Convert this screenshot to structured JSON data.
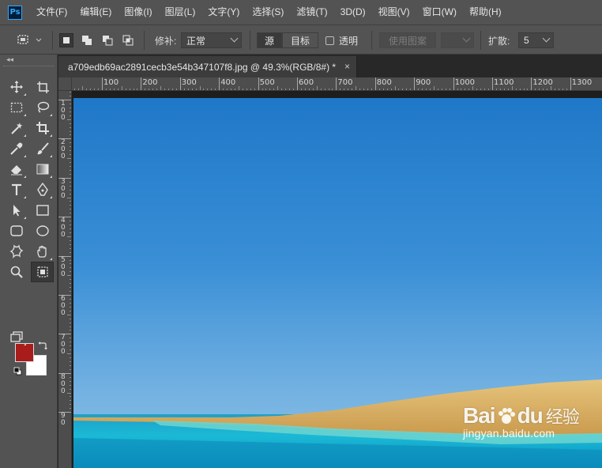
{
  "app": {
    "logo": "Ps",
    "icon": "photoshop-logo-icon"
  },
  "menu": [
    "文件(F)",
    "编辑(E)",
    "图像(I)",
    "图层(L)",
    "文字(Y)",
    "选择(S)",
    "滤镜(T)",
    "3D(D)",
    "视图(V)",
    "窗口(W)",
    "帮助(H)"
  ],
  "options": {
    "tool_preset_icon": "patch-tool-icon",
    "mode_icons": [
      "new-selection-icon",
      "add-to-selection-icon",
      "subtract-from-selection-icon",
      "intersect-selection-icon"
    ],
    "patch_label": "修补:",
    "patch_value": "正常",
    "source_label": "源",
    "target_label": "目标",
    "transparent_label": "透明",
    "transparent_checked": false,
    "use_pattern_label": "使用图案",
    "diffusion_label": "扩散:",
    "diffusion_value": "5"
  },
  "document": {
    "tab_title": "a709edb69ac2891cecb3e54b347107f8.jpg @ 49.3%(RGB/8#) *",
    "close_glyph": "×",
    "ruler_top": [
      "100",
      "200",
      "300",
      "400",
      "500",
      "600",
      "700",
      "800",
      "900",
      "1000",
      "1100",
      "1200",
      "1300"
    ],
    "ruler_left": [
      "1\n0\n0",
      "2\n0\n0",
      "3\n0\n0",
      "4\n0\n0",
      "5\n0\n0",
      "6\n0\n0",
      "7\n0\n0",
      "8\n0\n0",
      "9\n0"
    ]
  },
  "tools": [
    "move-tool-icon",
    "artboard-tool-icon",
    "rectangular-marquee-icon",
    "lasso-tool-icon",
    "magic-wand-icon",
    "crop-tool-icon",
    "eyedropper-icon",
    "brush-tool-icon",
    "eraser-tool-icon",
    "gradient-tool-icon",
    "type-tool-icon",
    "pen-tool-icon",
    "path-selection-icon",
    "rectangle-tool-icon",
    "rounded-rectangle-icon",
    "ellipse-tool-icon",
    "custom-shape-icon",
    "hand-tool-icon",
    "zoom-tool-icon",
    "patch-tool-icon"
  ],
  "colors": {
    "foreground": "#a81c1c",
    "background": "#ffffff",
    "accent": "#31a8ff"
  },
  "watermark": {
    "brand": "Bai",
    "brand2": "du",
    "brand_cn": "经验",
    "url": "jingyan.baidu.com"
  }
}
